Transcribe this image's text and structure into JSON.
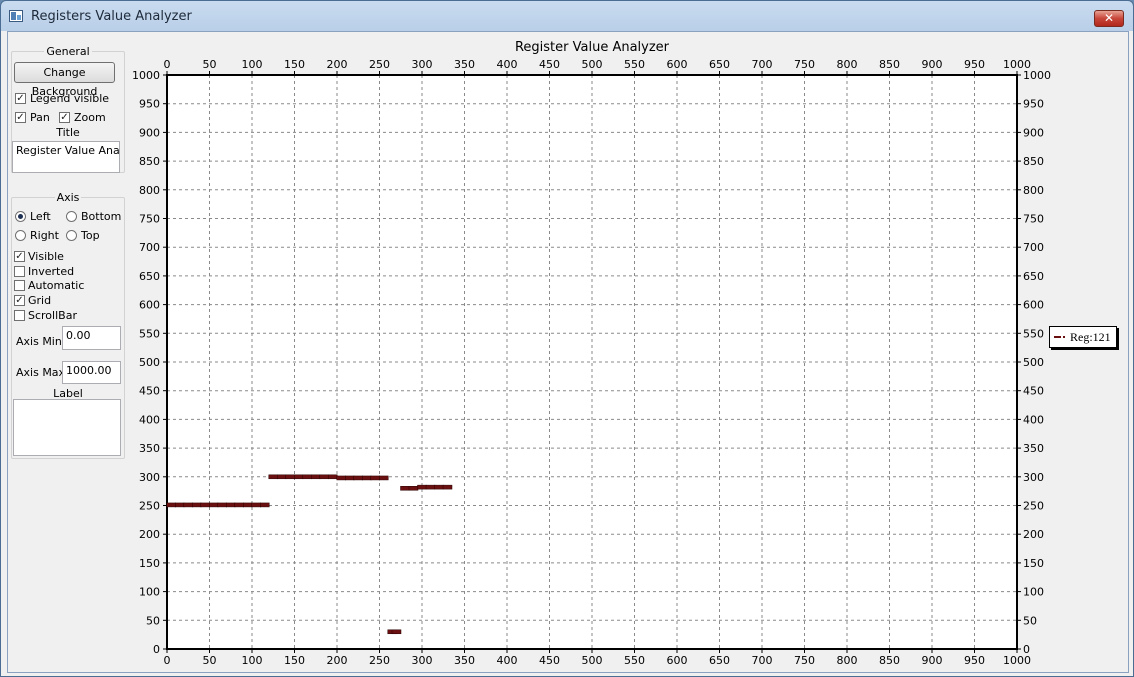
{
  "window": {
    "title": "Registers Value Analyzer",
    "close_label": "✕",
    "icon": "app-window-icon"
  },
  "general": {
    "group_label": "General",
    "change_background_label": "Change Background",
    "legend_visible": {
      "label": "Legend visible",
      "checked": true
    },
    "pan": {
      "label": "Pan",
      "checked": true
    },
    "zoom": {
      "label": "Zoom",
      "checked": true
    },
    "title_label": "Title",
    "title_value": "Register Value Analyzer"
  },
  "axis": {
    "group_label": "Axis",
    "radios": [
      {
        "label": "Left",
        "checked": true
      },
      {
        "label": "Bottom",
        "checked": false
      },
      {
        "label": "Right",
        "checked": false
      },
      {
        "label": "Top",
        "checked": false
      }
    ],
    "checks": [
      {
        "label": "Visible",
        "checked": true
      },
      {
        "label": "Inverted",
        "checked": false
      },
      {
        "label": "Automatic",
        "checked": false
      },
      {
        "label": "Grid",
        "checked": true
      },
      {
        "label": "ScrollBar",
        "checked": false
      }
    ],
    "min_label": "Axis Min",
    "min_value": "0.00",
    "max_label": "Axis Max",
    "max_value": "1000.00",
    "label_label": "Label",
    "label_value": ""
  },
  "chart_data": {
    "type": "scatter",
    "title": "Register Value Analyzer",
    "xlim": [
      0,
      1000
    ],
    "ylim": [
      0,
      1000
    ],
    "x_ticks": [
      0,
      50,
      100,
      150,
      200,
      250,
      300,
      350,
      400,
      450,
      500,
      550,
      600,
      650,
      700,
      750,
      800,
      850,
      900,
      950,
      1000
    ],
    "y_ticks": [
      0,
      50,
      100,
      150,
      200,
      250,
      300,
      350,
      400,
      450,
      500,
      550,
      600,
      650,
      700,
      750,
      800,
      850,
      900,
      950,
      1000
    ],
    "grid": true,
    "legend_position": "right",
    "series": [
      {
        "name": "Reg:121",
        "color": "#6b1010",
        "points": [
          [
            5,
            251
          ],
          [
            15,
            251
          ],
          [
            25,
            251
          ],
          [
            35,
            251
          ],
          [
            45,
            251
          ],
          [
            55,
            251
          ],
          [
            65,
            251
          ],
          [
            75,
            251
          ],
          [
            85,
            251
          ],
          [
            95,
            251
          ],
          [
            105,
            251
          ],
          [
            115,
            251
          ],
          [
            125,
            300
          ],
          [
            135,
            300
          ],
          [
            145,
            300
          ],
          [
            155,
            300
          ],
          [
            165,
            300
          ],
          [
            175,
            300
          ],
          [
            185,
            300
          ],
          [
            195,
            300
          ],
          [
            205,
            298
          ],
          [
            215,
            298
          ],
          [
            225,
            298
          ],
          [
            235,
            298
          ],
          [
            245,
            298
          ],
          [
            255,
            298
          ],
          [
            265,
            30
          ],
          [
            270,
            30
          ],
          [
            280,
            280
          ],
          [
            290,
            280
          ],
          [
            300,
            282
          ],
          [
            310,
            282
          ],
          [
            320,
            282
          ],
          [
            330,
            282
          ]
        ]
      }
    ]
  }
}
